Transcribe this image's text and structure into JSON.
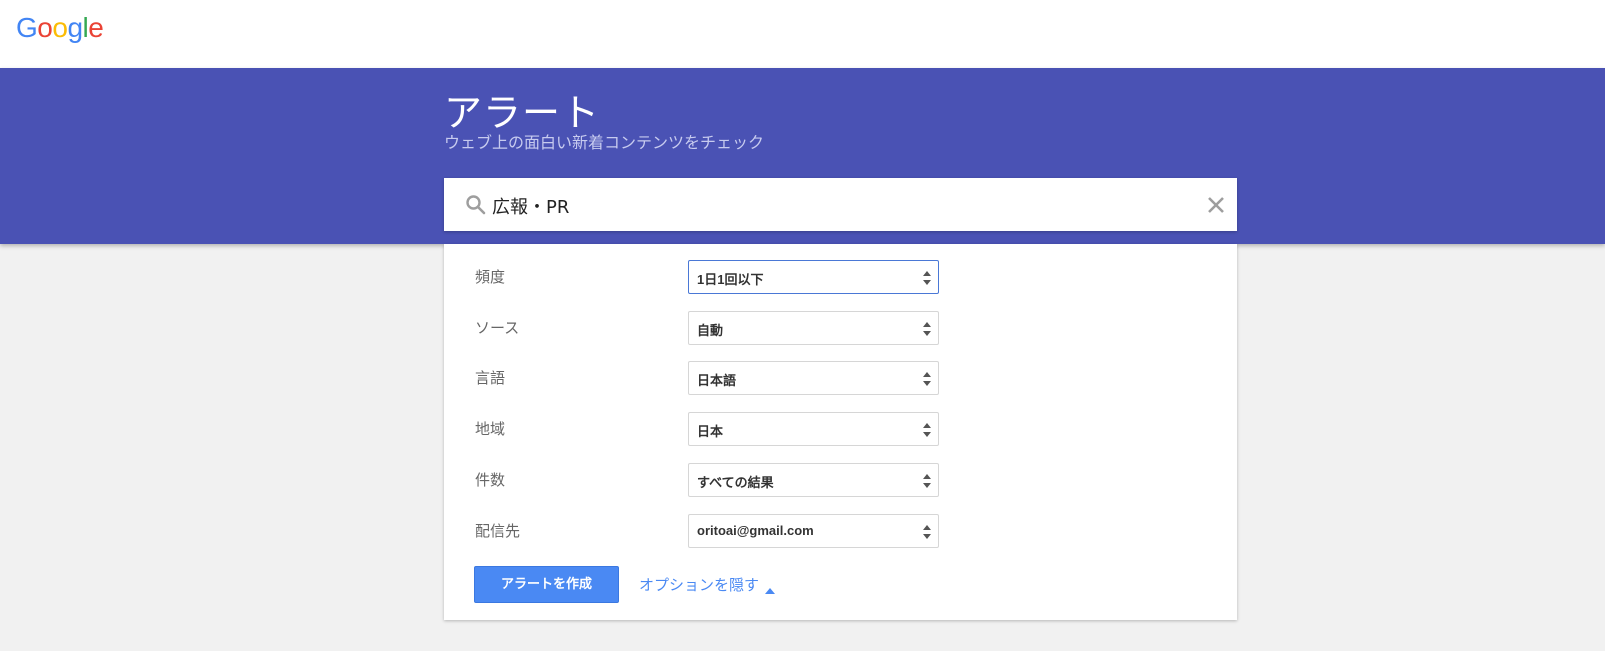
{
  "header": {
    "logo_letters": [
      {
        "char": "G",
        "color": "#4285f4"
      },
      {
        "char": "o",
        "color": "#ea4335"
      },
      {
        "char": "o",
        "color": "#fbbc05"
      },
      {
        "char": "g",
        "color": "#4285f4"
      },
      {
        "char": "l",
        "color": "#34a853"
      },
      {
        "char": "e",
        "color": "#ea4335"
      }
    ]
  },
  "hero": {
    "title": "アラート",
    "subtitle": "ウェブ上の面白い新着コンテンツをチェック",
    "background_color": "#4a52b4"
  },
  "search": {
    "icon": "search-icon",
    "value": "広報・PR",
    "clear_icon": "close-icon"
  },
  "options": {
    "rows": [
      {
        "label": "頻度",
        "value": "1日1回以下",
        "focused": true
      },
      {
        "label": "ソース",
        "value": "自動",
        "focused": false
      },
      {
        "label": "言語",
        "value": "日本語",
        "focused": false
      },
      {
        "label": "地域",
        "value": "日本",
        "focused": false
      },
      {
        "label": "件数",
        "value": "すべての結果",
        "focused": false
      },
      {
        "label": "配信先",
        "value": "oritoai@gmail.com",
        "focused": false
      }
    ]
  },
  "actions": {
    "create_label": "アラートを作成",
    "hide_options_label": "オプションを隠す",
    "accent_color": "#4a89f3"
  }
}
